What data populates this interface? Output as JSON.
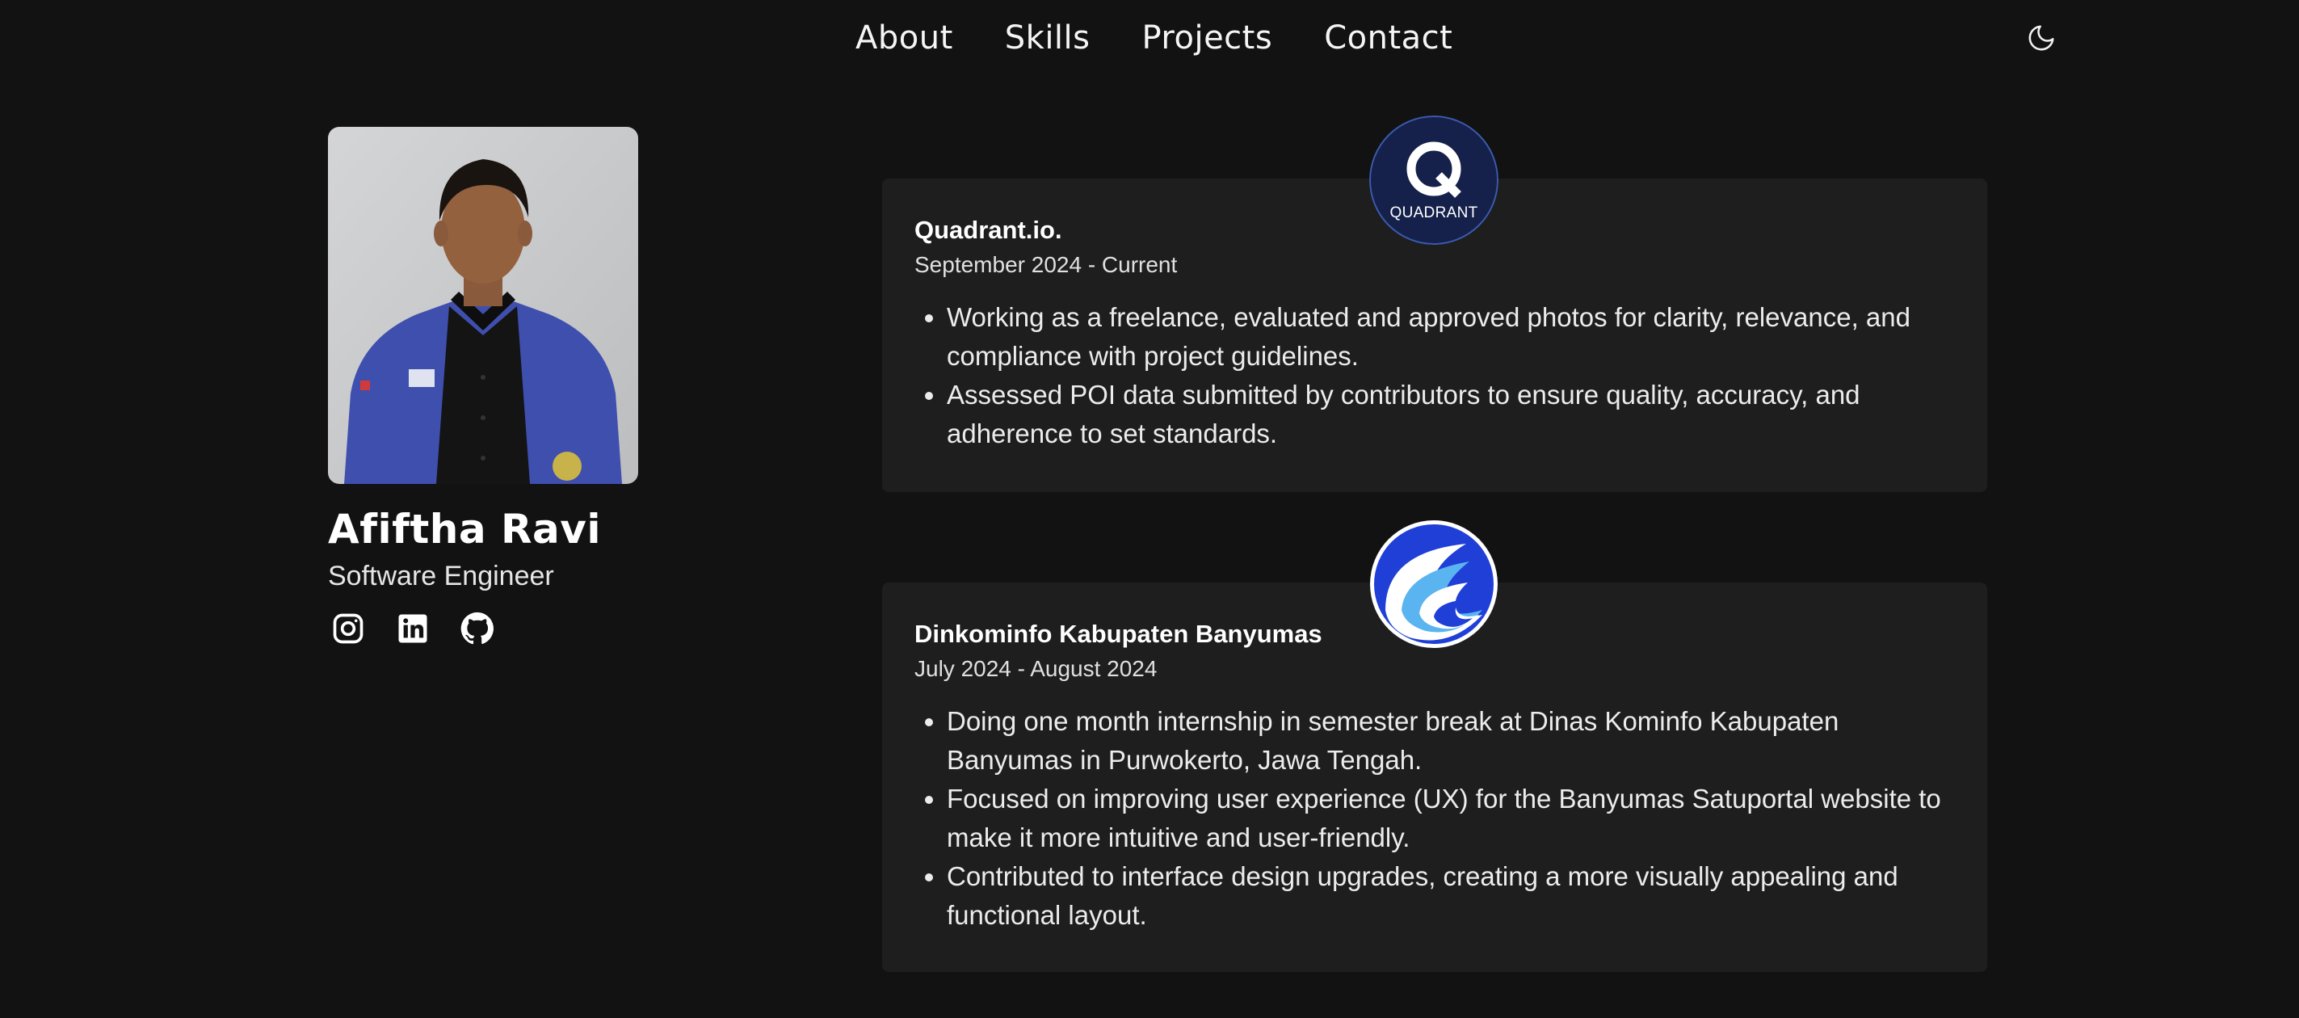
{
  "nav": {
    "links": [
      "About",
      "Skills",
      "Projects",
      "Contact"
    ],
    "theme_icon": "moon-icon"
  },
  "profile": {
    "name": "Afiftha Ravi",
    "role": "Software Engineer",
    "socials": [
      "instagram-icon",
      "linkedin-icon",
      "github-icon"
    ]
  },
  "experience": [
    {
      "company": "Quadrant.io.",
      "period": "September 2024 - Current",
      "logo_text": "QUADRANT",
      "logo_color": "#15214a",
      "bullets": [
        "Working as a freelance, evaluated and approved photos for clarity, relevance, and compliance with project guidelines.",
        "Assessed POI data submitted by contributors to ensure quality, accuracy, and adherence to set standards."
      ]
    },
    {
      "company": "Dinkominfo Kabupaten Banyumas",
      "period": "July 2024 - August 2024",
      "logo_color": "#1f3fd6",
      "bullets": [
        "Doing one month internship in semester break at Dinas Kominfo Kabupaten Banyumas in Purwokerto, Jawa Tengah.",
        "Focused on improving user experience (UX) for the Banyumas Satuportal website to make it more intuitive and user-friendly.",
        "Contributed to interface design upgrades, creating a more visually appealing and functional layout."
      ]
    }
  ],
  "colors": {
    "background": "#121212",
    "card": "#1e1e1e",
    "text": "#f2f2f2"
  }
}
